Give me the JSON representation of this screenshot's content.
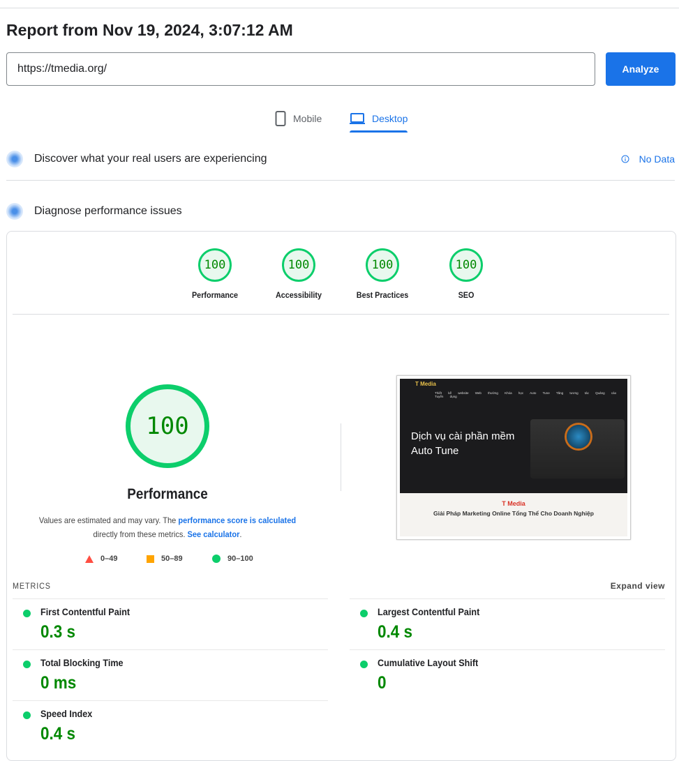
{
  "header": {
    "title": "Report from Nov 19, 2024, 3:07:12 AM",
    "url_value": "https://tmedia.org/",
    "analyze_label": "Analyze"
  },
  "tabs": [
    {
      "label": "Mobile",
      "icon": "phone-icon",
      "active": false
    },
    {
      "label": "Desktop",
      "icon": "laptop-icon",
      "active": true
    }
  ],
  "field_section": {
    "title": "Discover what your real users are experiencing",
    "status": "No Data"
  },
  "lab_section": {
    "title": "Diagnose performance issues"
  },
  "scores": [
    {
      "label": "Performance",
      "value": "100"
    },
    {
      "label": "Accessibility",
      "value": "100"
    },
    {
      "label": "Best Practices",
      "value": "100"
    },
    {
      "label": "SEO",
      "value": "100"
    }
  ],
  "performance": {
    "score": "100",
    "label": "Performance",
    "note_pre": "Values are estimated and may vary. The ",
    "note_link1": "performance score is calculated",
    "note_mid": " directly from these metrics. ",
    "note_link2": "See calculator",
    "note_end": "."
  },
  "legend": [
    {
      "range": "0–49",
      "color": "#ff4e42"
    },
    {
      "range": "50–89",
      "color": "#ffa400"
    },
    {
      "range": "90–100",
      "color": "#0cce6b"
    }
  ],
  "screenshot": {
    "brand": "T Media",
    "nav": "Thiết kế website Web thường Khóa học Auto Tune Tăng tương tác Quảng cáo Tuyển dụng",
    "hero": "Dịch vụ cài phần mềm Auto Tune",
    "lower_title": "T Media",
    "lower_sub": "Giải Pháp Marketing Online Tổng Thể Cho Doanh Nghiệp"
  },
  "metrics": {
    "heading": "METRICS",
    "expand": "Expand view",
    "items": [
      {
        "name": "First Contentful Paint",
        "value": "0.3 s"
      },
      {
        "name": "Largest Contentful Paint",
        "value": "0.4 s"
      },
      {
        "name": "Total Blocking Time",
        "value": "0 ms"
      },
      {
        "name": "Cumulative Layout Shift",
        "value": "0"
      },
      {
        "name": "Speed Index",
        "value": "0.4 s"
      }
    ]
  },
  "colors": {
    "accent": "#1a73e8",
    "pass": "#0cce6b",
    "pass_text": "#008800"
  }
}
